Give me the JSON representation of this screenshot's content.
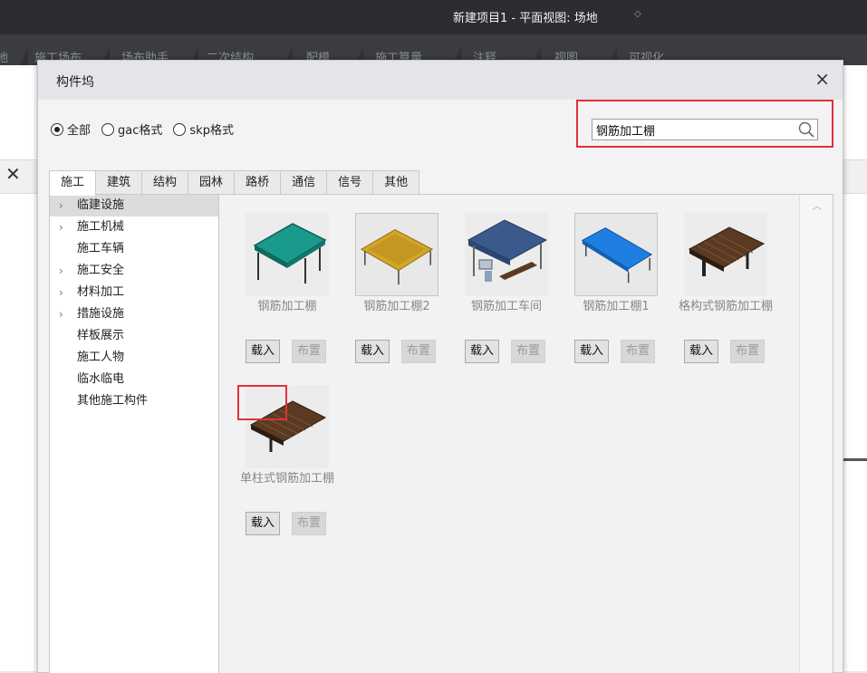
{
  "app": {
    "title": "新建项目1 - 平面视图: 场地",
    "ribbon_tabs": [
      "施工场布",
      "场布助手",
      "二次结构",
      "配模",
      "施工算量",
      "注释",
      "视图",
      "可视化"
    ]
  },
  "dialog": {
    "title": "构件坞",
    "close_glyph": "×",
    "filters": [
      {
        "label": "全部",
        "checked": true
      },
      {
        "label": "gac格式",
        "checked": false
      },
      {
        "label": "skp格式",
        "checked": false
      }
    ],
    "search": {
      "value": "钢筋加工棚",
      "placeholder": ""
    },
    "tabs": [
      "施工",
      "建筑",
      "结构",
      "园林",
      "路桥",
      "通信",
      "信号",
      "其他"
    ],
    "active_tab": "施工",
    "tree": [
      {
        "label": "临建设施",
        "expandable": true,
        "selected": true
      },
      {
        "label": "施工机械",
        "expandable": true,
        "selected": false
      },
      {
        "label": "施工车辆",
        "expandable": false,
        "selected": false
      },
      {
        "label": "施工安全",
        "expandable": true,
        "selected": false
      },
      {
        "label": "材料加工",
        "expandable": true,
        "selected": false
      },
      {
        "label": "措施设施",
        "expandable": true,
        "selected": false
      },
      {
        "label": "样板展示",
        "expandable": false,
        "selected": false
      },
      {
        "label": "施工人物",
        "expandable": false,
        "selected": false
      },
      {
        "label": "临水临电",
        "expandable": false,
        "selected": false
      },
      {
        "label": "其他施工构件",
        "expandable": false,
        "selected": false
      }
    ],
    "items": [
      {
        "name": "钢筋加工棚",
        "load_label": "载入",
        "place_label": "布置"
      },
      {
        "name": "钢筋加工棚2",
        "load_label": "载入",
        "place_label": "布置"
      },
      {
        "name": "钢筋加工车间",
        "load_label": "载入",
        "place_label": "布置"
      },
      {
        "name": "钢筋加工棚1",
        "load_label": "载入",
        "place_label": "布置"
      },
      {
        "name": "格构式钢筋加工棚",
        "load_label": "载入",
        "place_label": "布置"
      },
      {
        "name": "单柱式钢筋加工棚",
        "load_label": "载入",
        "place_label": "布置"
      }
    ]
  },
  "colors": {
    "highlight": "#e0313a",
    "teal_roof": "#1a9a8a",
    "gold_roof": "#d4a52a",
    "navy_roof": "#3a5a8c",
    "blue_roof": "#1e7fe0",
    "wood_roof": "#5a3a22"
  }
}
